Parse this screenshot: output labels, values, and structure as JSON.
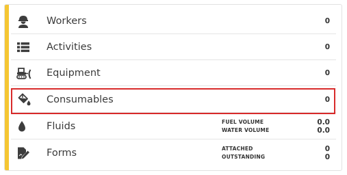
{
  "colors": {
    "accent": "#f5c633",
    "highlight": "#d82a2a",
    "icon": "#3d3d3d"
  },
  "rows": [
    {
      "icon": "worker-icon",
      "label": "Workers",
      "value": "0"
    },
    {
      "icon": "list-icon",
      "label": "Activities",
      "value": "0"
    },
    {
      "icon": "bulldozer-icon",
      "label": "Equipment",
      "value": "0"
    },
    {
      "icon": "paint-bucket-icon",
      "label": "Consumables",
      "value": "0"
    },
    {
      "icon": "droplet-icon",
      "label": "Fluids",
      "details": [
        {
          "label": "FUEL VOLUME",
          "value": "0.0"
        },
        {
          "label": "WATER VOLUME",
          "value": "0.0"
        }
      ]
    },
    {
      "icon": "form-edit-icon",
      "label": "Forms",
      "details": [
        {
          "label": "ATTACHED",
          "value": "0"
        },
        {
          "label": "OUTSTANDING",
          "value": "0"
        }
      ]
    }
  ]
}
